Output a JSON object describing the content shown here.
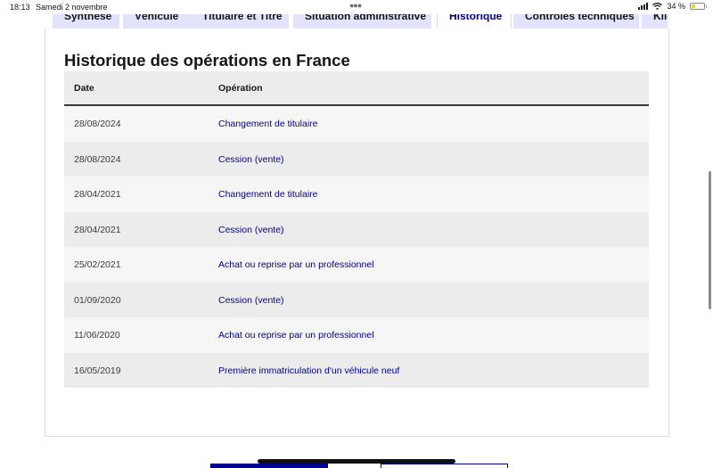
{
  "status_bar": {
    "time": "18:13",
    "date": "Samedi 2 novembre",
    "battery": "34 %"
  },
  "tabs": [
    {
      "label": "Synthèse",
      "active": false
    },
    {
      "label": "Véhicule",
      "active": false
    },
    {
      "label": "Titulaire et Titre",
      "active": false
    },
    {
      "label": "Situation administrative",
      "active": false
    },
    {
      "label": "Historique",
      "active": true
    },
    {
      "label": "Contrôles techniques",
      "active": false
    },
    {
      "label": "Kilométrage",
      "active": false
    }
  ],
  "section": {
    "title": "Historique des opérations en France"
  },
  "table": {
    "headers": {
      "date": "Date",
      "operation": "Opération"
    },
    "rows": [
      {
        "date": "28/08/2024",
        "operation": "Changement de titulaire"
      },
      {
        "date": "28/08/2024",
        "operation": "Cession (vente)"
      },
      {
        "date": "28/04/2021",
        "operation": "Changement de titulaire"
      },
      {
        "date": "28/04/2021",
        "operation": "Cession (vente)"
      },
      {
        "date": "25/02/2021",
        "operation": "Achat ou reprise par un professionnel"
      },
      {
        "date": "01/09/2020",
        "operation": "Cession (vente)"
      },
      {
        "date": "11/06/2020",
        "operation": "Achat ou reprise par un professionnel"
      },
      {
        "date": "16/05/2019",
        "operation": "Première immatriculation d'un véhicule neuf"
      }
    ]
  },
  "colors": {
    "accent": "#000091",
    "tab_bg": "#e3e3fd",
    "row_alt": "#ececec",
    "row": "#f6f6f6",
    "battery": "#f7c325"
  },
  "icons": [
    "signal-icon",
    "wifi-icon",
    "battery-icon"
  ],
  "battery_level": 0.34
}
